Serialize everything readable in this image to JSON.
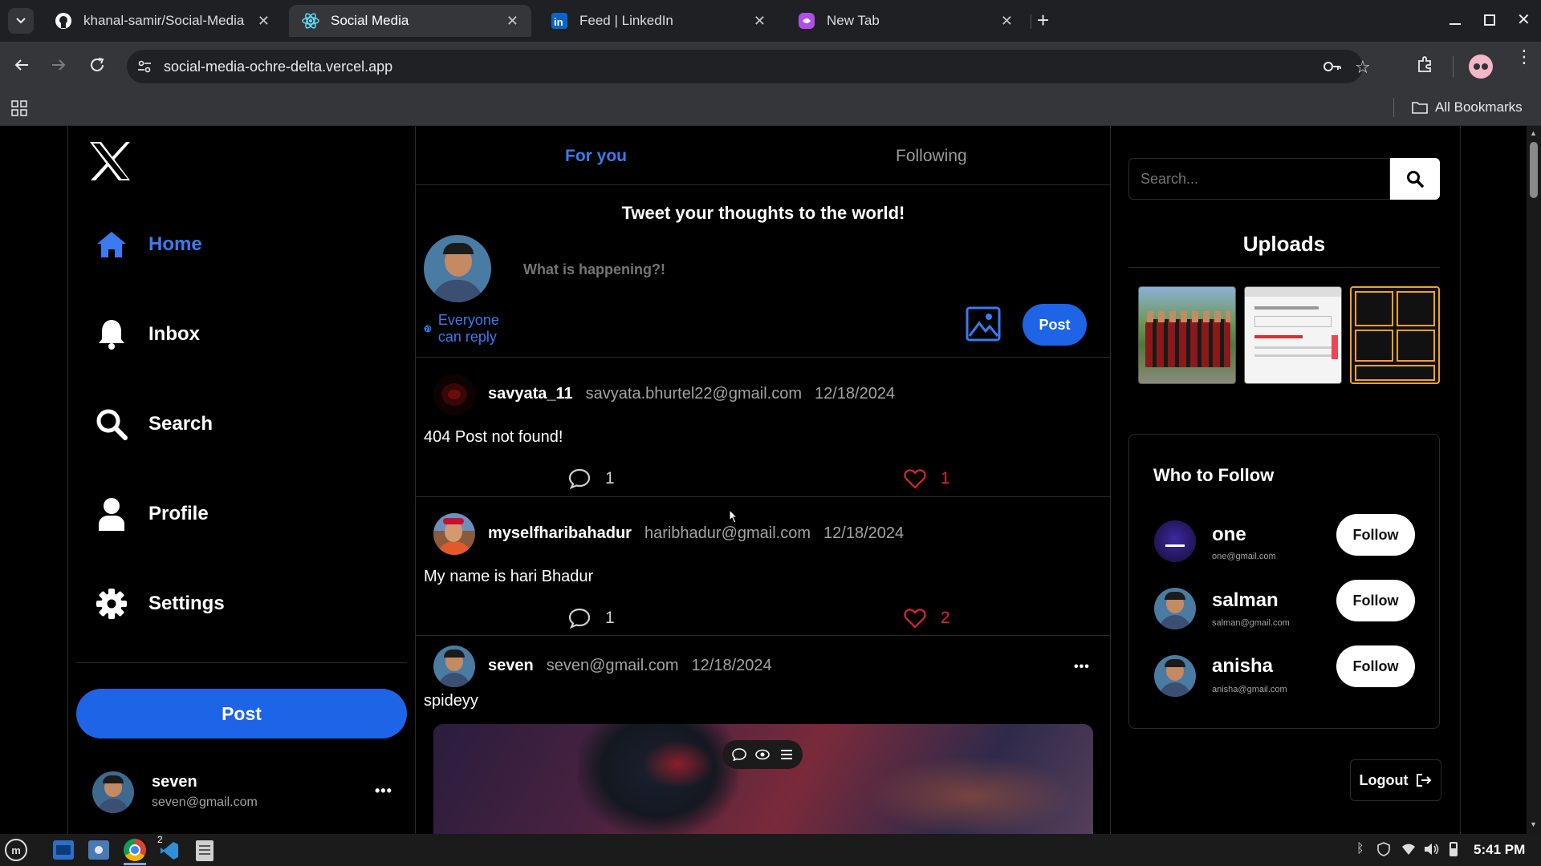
{
  "browser": {
    "tabs": [
      {
        "title": "khanal-samir/Social-Media",
        "icon": "github-icon"
      },
      {
        "title": "Social Media",
        "icon": "react-icon",
        "active": true
      },
      {
        "title": "Feed | LinkedIn",
        "icon": "linkedin-icon"
      },
      {
        "title": "New Tab",
        "icon": "newtab-icon"
      }
    ],
    "url": "social-media-ochre-delta.vercel.app",
    "bookmarks_label": "All Bookmarks"
  },
  "sidebar": {
    "logo": "X",
    "items": [
      {
        "label": "Home",
        "icon": "home-icon",
        "active": true
      },
      {
        "label": "Inbox",
        "icon": "bell-icon"
      },
      {
        "label": "Search",
        "icon": "search-icon"
      },
      {
        "label": "Profile",
        "icon": "user-icon"
      },
      {
        "label": "Settings",
        "icon": "gear-icon"
      }
    ],
    "post_label": "Post",
    "user": {
      "name": "seven",
      "email": "seven@gmail.com",
      "more": "•••"
    }
  },
  "feed": {
    "tabs": [
      "For you",
      "Following"
    ],
    "composer": {
      "heading": "Tweet your thoughts to the world!",
      "placeholder": "What is happening?!",
      "reply_setting": "Everyone can reply",
      "post_label": "Post"
    },
    "posts": [
      {
        "username": "savyata_11",
        "email": "savyata.bhurtel22@gmail.com",
        "date": "12/18/2024",
        "text": "404 Post not found!",
        "comments": "1",
        "likes": "1"
      },
      {
        "username": "myselfharibahadur",
        "email": "haribhadur@gmail.com",
        "date": "12/18/2024",
        "text": "My name is hari Bhadur",
        "comments": "1",
        "likes": "2"
      },
      {
        "username": "seven",
        "email": "seven@gmail.com",
        "date": "12/18/2024",
        "text": "spideyy",
        "more": "•••"
      }
    ]
  },
  "right": {
    "search_placeholder": "Search...",
    "uploads_title": "Uploads",
    "who_to_follow_title": "Who to Follow",
    "follow_label": "Follow",
    "suggestions": [
      {
        "name": "one",
        "email": "one@gmail.com"
      },
      {
        "name": "salman",
        "email": "salman@gmail.com"
      },
      {
        "name": "anisha",
        "email": "anisha@gmail.com"
      }
    ],
    "logout_label": "Logout"
  },
  "taskbar": {
    "clock": "5:41 PM",
    "badge": "2"
  },
  "colors": {
    "accent": "#1d64e6",
    "like": "#e0242f",
    "background": "#000000"
  }
}
